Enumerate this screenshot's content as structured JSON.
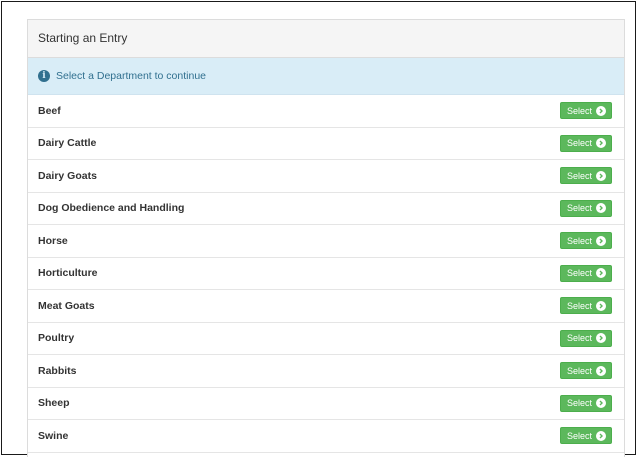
{
  "panel": {
    "heading": "Starting an Entry",
    "info_text": "Select a Department to continue",
    "info_icon": "info-circle-icon",
    "select_label": "Select",
    "select_icon": "chevron-right-circle-icon",
    "button_color": "#5cb85c",
    "info_color": "#d9edf7"
  },
  "departments": [
    "Beef",
    "Dairy Cattle",
    "Dairy Goats",
    "Dog Obedience and Handling",
    "Horse",
    "Horticulture",
    "Meat Goats",
    "Poultry",
    "Rabbits",
    "Sheep",
    "Swine"
  ]
}
